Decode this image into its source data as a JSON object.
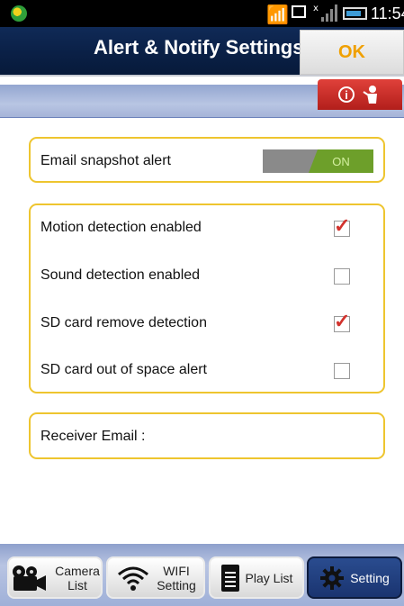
{
  "status": {
    "time": "11:54"
  },
  "header": {
    "title": "Alert & Notify Settings",
    "ok_label": "OK"
  },
  "settings": {
    "email_snapshot_alert": {
      "label": "Email snapshot alert",
      "toggle_text": "ON",
      "enabled": true
    },
    "detections": [
      {
        "label": "Motion detection enabled",
        "checked": true
      },
      {
        "label": "Sound detection enabled",
        "checked": false
      },
      {
        "label": "SD card remove detection",
        "checked": true
      },
      {
        "label": "SD card out of space alert",
        "checked": false
      }
    ],
    "receiver_email_label": "Receiver Email :"
  },
  "tabs": [
    {
      "label_line1": "Camera",
      "label_line2": "List",
      "icon": "camera-icon"
    },
    {
      "label_line1": "WIFI",
      "label_line2": "Setting",
      "icon": "wifi-icon"
    },
    {
      "label_line1": "Play List",
      "label_line2": "",
      "icon": "playlist-icon"
    },
    {
      "label_line1": "Setting",
      "label_line2": "",
      "icon": "gear-icon",
      "active": true
    }
  ],
  "colors": {
    "title_bg": "#0a2046",
    "accent_yellow": "#eec52f",
    "toggle_on": "#6d9f2a",
    "check_red": "#d2322d",
    "ok_text": "#f0a000"
  }
}
